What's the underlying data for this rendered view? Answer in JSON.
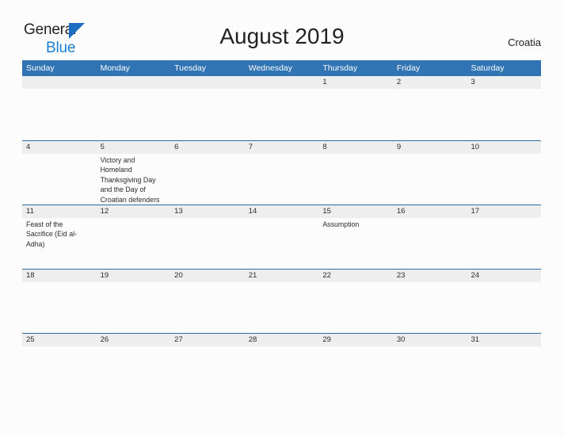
{
  "brand": {
    "word1": "General",
    "word2": "Blue",
    "triangle_color": "#1b6ec2",
    "word2_color": "#1b7fd4"
  },
  "header": {
    "title": "August 2019",
    "region": "Croatia"
  },
  "calendar": {
    "weekday_headers": [
      "Sunday",
      "Monday",
      "Tuesday",
      "Wednesday",
      "Thursday",
      "Friday",
      "Saturday"
    ],
    "header_bg": "#3074b4",
    "row_rule_color": "#2e6da4",
    "date_band_bg": "#eeeeee",
    "weeks": [
      [
        {
          "date": "",
          "events": []
        },
        {
          "date": "",
          "events": []
        },
        {
          "date": "",
          "events": []
        },
        {
          "date": "",
          "events": []
        },
        {
          "date": "1",
          "events": []
        },
        {
          "date": "2",
          "events": []
        },
        {
          "date": "3",
          "events": []
        }
      ],
      [
        {
          "date": "4",
          "events": []
        },
        {
          "date": "5",
          "events": [
            "Victory and Homeland Thanksgiving Day and the Day of Croatian defenders"
          ]
        },
        {
          "date": "6",
          "events": []
        },
        {
          "date": "7",
          "events": []
        },
        {
          "date": "8",
          "events": []
        },
        {
          "date": "9",
          "events": []
        },
        {
          "date": "10",
          "events": []
        }
      ],
      [
        {
          "date": "11",
          "events": [
            "Feast of the Sacrifice (Eid al-Adha)"
          ]
        },
        {
          "date": "12",
          "events": []
        },
        {
          "date": "13",
          "events": []
        },
        {
          "date": "14",
          "events": []
        },
        {
          "date": "15",
          "events": [
            "Assumption"
          ]
        },
        {
          "date": "16",
          "events": []
        },
        {
          "date": "17",
          "events": []
        }
      ],
      [
        {
          "date": "18",
          "events": []
        },
        {
          "date": "19",
          "events": []
        },
        {
          "date": "20",
          "events": []
        },
        {
          "date": "21",
          "events": []
        },
        {
          "date": "22",
          "events": []
        },
        {
          "date": "23",
          "events": []
        },
        {
          "date": "24",
          "events": []
        }
      ],
      [
        {
          "date": "25",
          "events": []
        },
        {
          "date": "26",
          "events": []
        },
        {
          "date": "27",
          "events": []
        },
        {
          "date": "28",
          "events": []
        },
        {
          "date": "29",
          "events": []
        },
        {
          "date": "30",
          "events": []
        },
        {
          "date": "31",
          "events": []
        }
      ]
    ]
  }
}
